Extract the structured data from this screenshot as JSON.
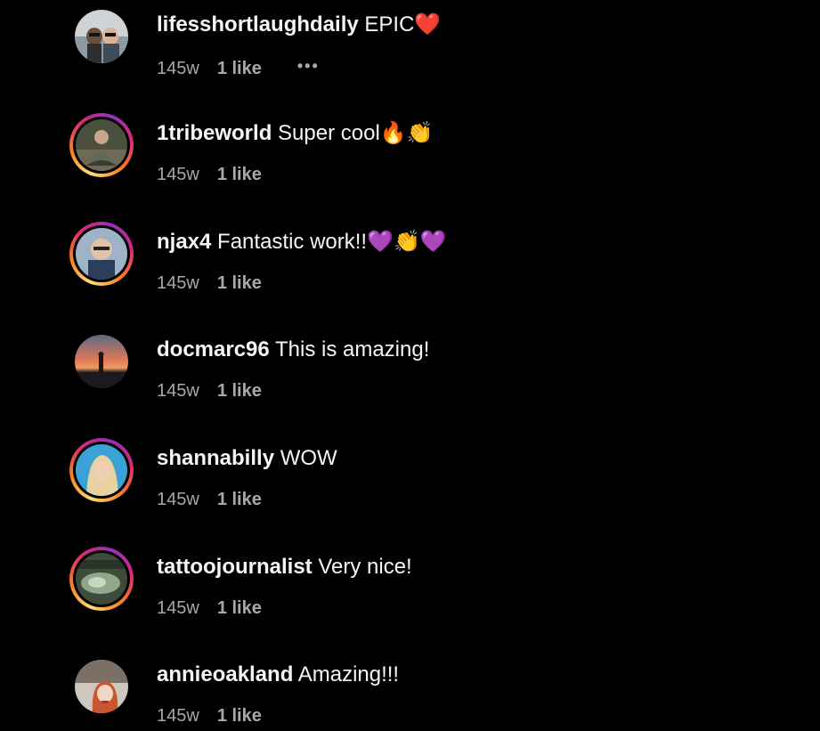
{
  "comments": [
    {
      "username": "lifesshortlaughdaily",
      "text": "EPIC",
      "emoji": "❤️",
      "time": "145w",
      "likes": "1 like",
      "more_icon": "•••",
      "story_ring": false
    },
    {
      "username": "1tribeworld",
      "text": "Super cool",
      "emoji": "🔥👏",
      "time": "145w",
      "likes": "1 like",
      "story_ring": true
    },
    {
      "username": "njax4",
      "text": "Fantastic work!!",
      "emoji": "💜👏💜",
      "time": "145w",
      "likes": "1 like",
      "story_ring": true
    },
    {
      "username": "docmarc96",
      "text": "This is amazing!",
      "emoji": "",
      "time": "145w",
      "likes": "1 like",
      "story_ring": false
    },
    {
      "username": "shannabilly",
      "text": "WOW",
      "emoji": "",
      "time": "145w",
      "likes": "1 like",
      "story_ring": true
    },
    {
      "username": "tattoojournalist",
      "text": "Very nice!",
      "emoji": "",
      "time": "145w",
      "likes": "1 like",
      "story_ring": true
    },
    {
      "username": "annieoakland",
      "text": "Amazing!!!",
      "emoji": "",
      "time": "145w",
      "likes": "1 like",
      "story_ring": false
    }
  ],
  "colors": {
    "background": "#000000",
    "primary_text": "#f5f5f5",
    "secondary_text": "#a8a8a8",
    "story_ring_gradient": [
      "#feda75",
      "#fa7e1e",
      "#d62976",
      "#962fbf"
    ]
  }
}
